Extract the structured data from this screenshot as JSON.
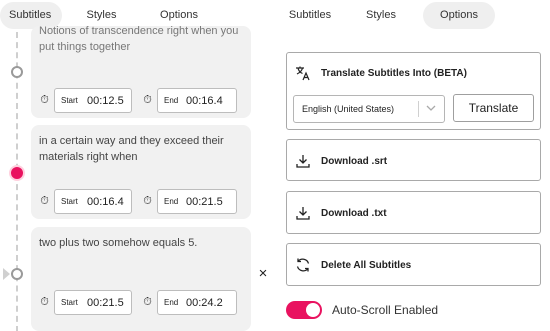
{
  "left_tabs": [
    {
      "label": "Subtitles",
      "active": true
    },
    {
      "label": "Styles",
      "active": false
    },
    {
      "label": "Options",
      "active": false
    }
  ],
  "right_tabs": [
    {
      "label": "Subtitles",
      "active": false
    },
    {
      "label": "Styles",
      "active": false
    },
    {
      "label": "Options",
      "active": true
    }
  ],
  "subtitles": [
    {
      "text": "Notions of transcendence right when you put things together",
      "start_label": "Start",
      "start": "00:12.5",
      "end_label": "End",
      "end": "00:16.4"
    },
    {
      "text": "in a certain way and they exceed their materials right when",
      "start_label": "Start",
      "start": "00:16.4",
      "end_label": "End",
      "end": "00:21.5"
    },
    {
      "text": "two plus two somehow equals 5.",
      "start_label": "Start",
      "start": "00:21.5",
      "end_label": "End",
      "end": "00:24.2"
    }
  ],
  "close_symbol": "×",
  "options": {
    "translate_title": "Translate Subtitles Into (BETA)",
    "language_selected": "English (United States)",
    "translate_button": "Translate",
    "download_srt": "Download .srt",
    "download_txt": "Download .txt",
    "delete_all": "Delete All Subtitles",
    "auto_scroll_label": "Auto-Scroll Enabled",
    "auto_scroll_on": true
  },
  "colors": {
    "accent": "#e9125f"
  },
  "icons": {
    "translate": "translate-icon",
    "download": "download-icon",
    "refresh": "refresh-icon",
    "stopwatch": "stopwatch-icon",
    "chevron": "chevron-down-icon"
  }
}
